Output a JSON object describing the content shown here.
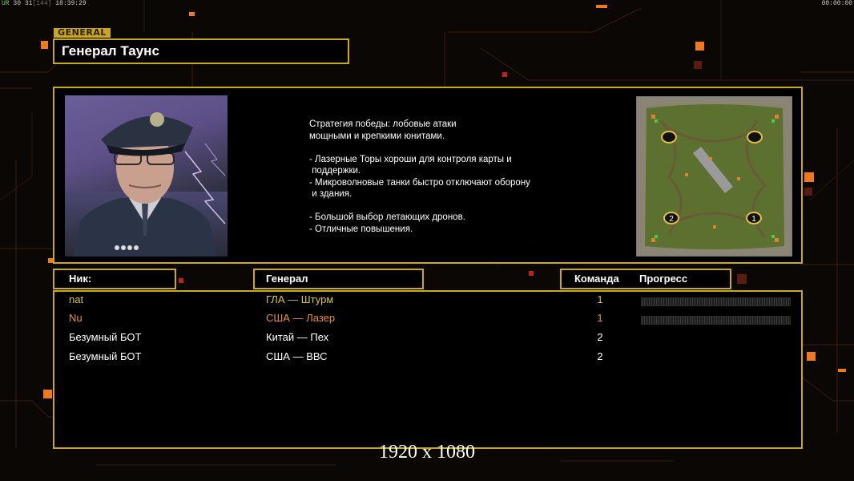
{
  "hud": {
    "top_left_a": "UR",
    "top_left_b": "30 31",
    "top_left_c": "[144]",
    "top_left_time": "18:39:29",
    "top_right_time": "00:00:00"
  },
  "general": {
    "tag": "GENERAL",
    "name": "Генерал Таунс"
  },
  "description": [
    "Стратегия победы: лобовые атаки",
    "мощными и крепкими юнитами.",
    "",
    "- Лазерные Торы хороши для контроля карты и",
    " поддержки.",
    "- Микроволновые танки быстро отключают оборону",
    " и здания.",
    "",
    "- Большой выбор летающих дронов.",
    "- Отличные повышения."
  ],
  "minimap": {
    "spawn_labels": [
      "2",
      "1"
    ]
  },
  "table": {
    "headers": {
      "nick": "Ник:",
      "general": "Генерал",
      "team": "Команда",
      "progress": "Прогресс"
    },
    "rows": [
      {
        "nick": "nat",
        "general": "ГЛА — Штурм",
        "team": "1",
        "color": "#d8c43b",
        "show_progress": true
      },
      {
        "nick": "Nu",
        "general": "США — Лазер",
        "team": "1",
        "color": "#e8932a",
        "show_progress": true
      },
      {
        "nick": "Безумный БОТ",
        "general": "Китай — Пех",
        "team": "2",
        "color": "#ffffff",
        "show_progress": false
      },
      {
        "nick": "Безумный БОТ",
        "general": "США — ВВС",
        "team": "2",
        "color": "#ffffff",
        "show_progress": false
      }
    ]
  },
  "resolution_label": "1920 x 1080",
  "colors": {
    "frame": "#c9aa1f",
    "accent_orange": "#f07a1a",
    "background": "#0b0705"
  }
}
